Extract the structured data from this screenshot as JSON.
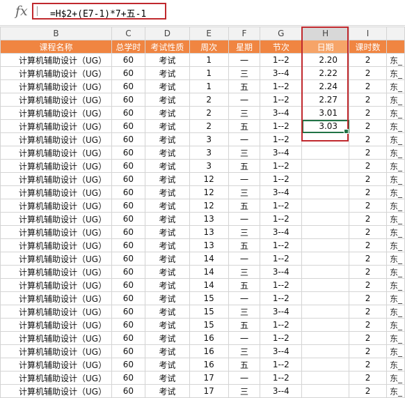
{
  "formula_bar": {
    "fx_label": "fx",
    "formula": "=H$2+(E7-1)*7+五-1"
  },
  "columns": [
    "B",
    "C",
    "D",
    "E",
    "F",
    "G",
    "H",
    "I",
    ""
  ],
  "selected_column": "H",
  "header_row": [
    "课程名称",
    "总学时",
    "考试性质",
    "周次",
    "星期",
    "节次",
    "日期",
    "课时数",
    ""
  ],
  "rows": [
    {
      "course": "计算机辅助设计（UG）",
      "hours": "60",
      "exam": "考试",
      "week": "1",
      "day": "一",
      "period": "1--2",
      "date": "2.20",
      "credits": "2",
      "extra": "东_"
    },
    {
      "course": "计算机辅助设计（UG）",
      "hours": "60",
      "exam": "考试",
      "week": "1",
      "day": "三",
      "period": "3--4",
      "date": "2.22",
      "credits": "2",
      "extra": "东_"
    },
    {
      "course": "计算机辅助设计（UG）",
      "hours": "60",
      "exam": "考试",
      "week": "1",
      "day": "五",
      "period": "1--2",
      "date": "2.24",
      "credits": "2",
      "extra": "东_"
    },
    {
      "course": "计算机辅助设计（UG）",
      "hours": "60",
      "exam": "考试",
      "week": "2",
      "day": "一",
      "period": "1--2",
      "date": "2.27",
      "credits": "2",
      "extra": "东_"
    },
    {
      "course": "计算机辅助设计（UG）",
      "hours": "60",
      "exam": "考试",
      "week": "2",
      "day": "三",
      "period": "3--4",
      "date": "3.01",
      "credits": "2",
      "extra": "东_"
    },
    {
      "course": "计算机辅助设计（UG）",
      "hours": "60",
      "exam": "考试",
      "week": "2",
      "day": "五",
      "period": "1--2",
      "date": "3.03",
      "credits": "2",
      "extra": "东_"
    },
    {
      "course": "计算机辅助设计（UG）",
      "hours": "60",
      "exam": "考试",
      "week": "3",
      "day": "一",
      "period": "1--2",
      "date": "",
      "credits": "2",
      "extra": "东_"
    },
    {
      "course": "计算机辅助设计（UG）",
      "hours": "60",
      "exam": "考试",
      "week": "3",
      "day": "三",
      "period": "3--4",
      "date": "",
      "credits": "2",
      "extra": "东_"
    },
    {
      "course": "计算机辅助设计（UG）",
      "hours": "60",
      "exam": "考试",
      "week": "3",
      "day": "五",
      "period": "1--2",
      "date": "",
      "credits": "2",
      "extra": "东_"
    },
    {
      "course": "计算机辅助设计（UG）",
      "hours": "60",
      "exam": "考试",
      "week": "12",
      "day": "一",
      "period": "1--2",
      "date": "",
      "credits": "2",
      "extra": "东_"
    },
    {
      "course": "计算机辅助设计（UG）",
      "hours": "60",
      "exam": "考试",
      "week": "12",
      "day": "三",
      "period": "3--4",
      "date": "",
      "credits": "2",
      "extra": "东_"
    },
    {
      "course": "计算机辅助设计（UG）",
      "hours": "60",
      "exam": "考试",
      "week": "12",
      "day": "五",
      "period": "1--2",
      "date": "",
      "credits": "2",
      "extra": "东_"
    },
    {
      "course": "计算机辅助设计（UG）",
      "hours": "60",
      "exam": "考试",
      "week": "13",
      "day": "一",
      "period": "1--2",
      "date": "",
      "credits": "2",
      "extra": "东_"
    },
    {
      "course": "计算机辅助设计（UG）",
      "hours": "60",
      "exam": "考试",
      "week": "13",
      "day": "三",
      "period": "3--4",
      "date": "",
      "credits": "2",
      "extra": "东_"
    },
    {
      "course": "计算机辅助设计（UG）",
      "hours": "60",
      "exam": "考试",
      "week": "13",
      "day": "五",
      "period": "1--2",
      "date": "",
      "credits": "2",
      "extra": "东_"
    },
    {
      "course": "计算机辅助设计（UG）",
      "hours": "60",
      "exam": "考试",
      "week": "14",
      "day": "一",
      "period": "1--2",
      "date": "",
      "credits": "2",
      "extra": "东_"
    },
    {
      "course": "计算机辅助设计（UG）",
      "hours": "60",
      "exam": "考试",
      "week": "14",
      "day": "三",
      "period": "3--4",
      "date": "",
      "credits": "2",
      "extra": "东_"
    },
    {
      "course": "计算机辅助设计（UG）",
      "hours": "60",
      "exam": "考试",
      "week": "14",
      "day": "五",
      "period": "1--2",
      "date": "",
      "credits": "2",
      "extra": "东_"
    },
    {
      "course": "计算机辅助设计（UG）",
      "hours": "60",
      "exam": "考试",
      "week": "15",
      "day": "一",
      "period": "1--2",
      "date": "",
      "credits": "2",
      "extra": "东_"
    },
    {
      "course": "计算机辅助设计（UG）",
      "hours": "60",
      "exam": "考试",
      "week": "15",
      "day": "三",
      "period": "3--4",
      "date": "",
      "credits": "2",
      "extra": "东_"
    },
    {
      "course": "计算机辅助设计（UG）",
      "hours": "60",
      "exam": "考试",
      "week": "15",
      "day": "五",
      "period": "1--2",
      "date": "",
      "credits": "2",
      "extra": "东_"
    },
    {
      "course": "计算机辅助设计（UG）",
      "hours": "60",
      "exam": "考试",
      "week": "16",
      "day": "一",
      "period": "1--2",
      "date": "",
      "credits": "2",
      "extra": "东_"
    },
    {
      "course": "计算机辅助设计（UG）",
      "hours": "60",
      "exam": "考试",
      "week": "16",
      "day": "三",
      "period": "3--4",
      "date": "",
      "credits": "2",
      "extra": "东_"
    },
    {
      "course": "计算机辅助设计（UG）",
      "hours": "60",
      "exam": "考试",
      "week": "16",
      "day": "五",
      "period": "1--2",
      "date": "",
      "credits": "2",
      "extra": "东_"
    },
    {
      "course": "计算机辅助设计（UG）",
      "hours": "60",
      "exam": "考试",
      "week": "17",
      "day": "一",
      "period": "1--2",
      "date": "",
      "credits": "2",
      "extra": "东_"
    },
    {
      "course": "计算机辅助设计（UG）",
      "hours": "60",
      "exam": "考试",
      "week": "17",
      "day": "三",
      "period": "3--4",
      "date": "",
      "credits": "2",
      "extra": "东_"
    }
  ],
  "active_cell_row": 5,
  "colors": {
    "header_orange": "#f08541",
    "highlight_red": "#c0282d",
    "selection_green": "#217346"
  }
}
